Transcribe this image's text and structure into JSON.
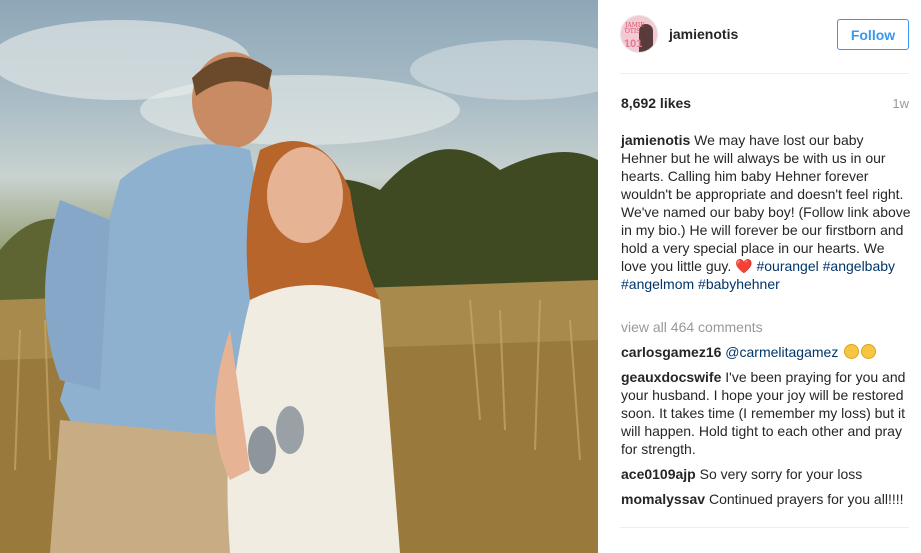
{
  "post": {
    "username": "jamienotis",
    "follow_label": "Follow",
    "likes": "8,692 likes",
    "age": "1w",
    "avatar_text": "JAMIE\nOTIS",
    "avatar_num": "101",
    "caption": {
      "user": "jamienotis",
      "text": "We may have lost our baby Hehner but he will always be with us in our hearts. Calling him baby Hehner forever wouldn't be appropriate and doesn't feel right. We've named our baby boy! (Follow link above in my bio.) He will forever be our firstborn and hold a very special place in our hearts. We love you little guy.",
      "heart": "❤️",
      "tags": [
        "#ourangel",
        "#angelbaby",
        "#angelmom",
        "#babyhehner"
      ]
    },
    "view_all": "view all 464 comments",
    "comments": [
      {
        "user": "carlosgamez16",
        "mention": "@carmelitagamez",
        "text": "",
        "emoji_count": 2
      },
      {
        "user": "geauxdocswife",
        "mention": "",
        "text": "I've been praying for you and your husband. I hope your joy will be restored soon. It takes time (I remember my loss) but it will happen. Hold tight to each other and pray for strength.",
        "emoji_count": 0
      },
      {
        "user": "ace0109ajp",
        "mention": "",
        "text": "So very sorry for your loss",
        "emoji_count": 0
      },
      {
        "user": "momalyssav",
        "mention": "",
        "text": "Continued prayers for you all!!!!",
        "emoji_count": 0
      }
    ]
  },
  "colors": {
    "accent": "#3897f0",
    "hashtag": "#003569",
    "muted": "#999999",
    "text": "#262626"
  }
}
